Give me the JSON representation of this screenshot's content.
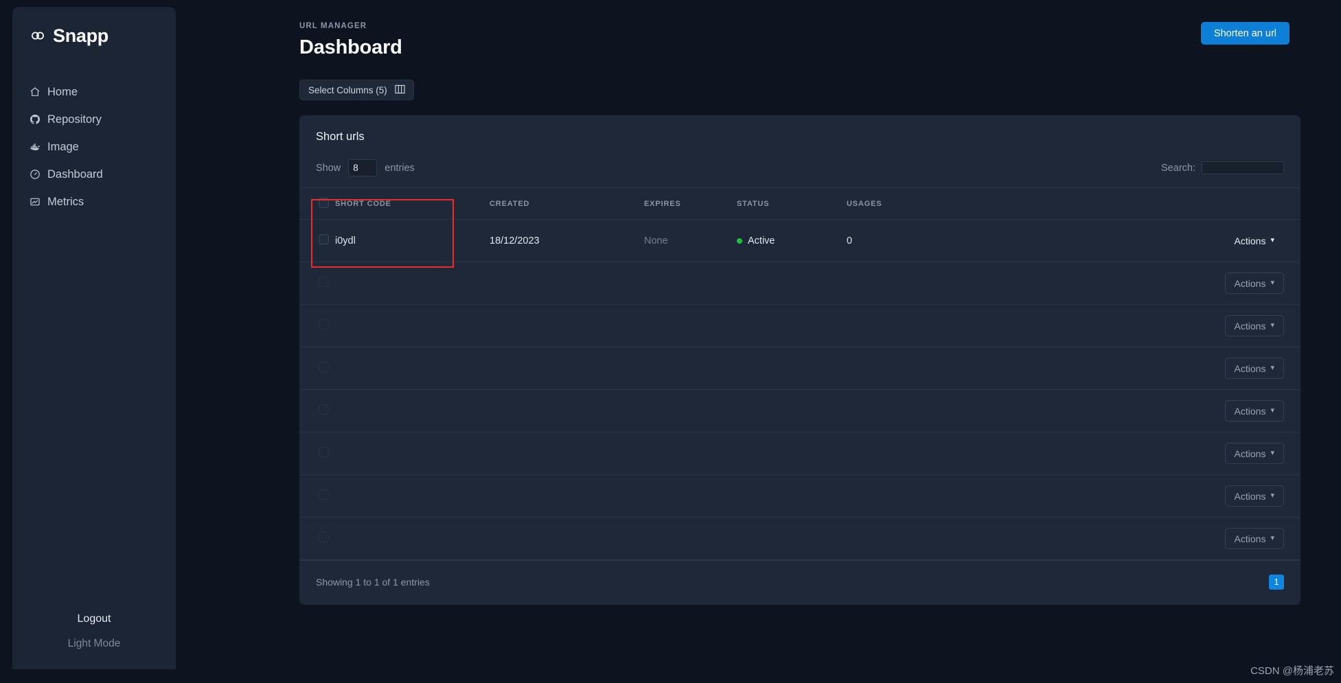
{
  "brand": {
    "name": "Snapp",
    "icon": "links-icon"
  },
  "sidebar": {
    "items": [
      {
        "label": "Home",
        "icon": "home-icon"
      },
      {
        "label": "Repository",
        "icon": "github-icon"
      },
      {
        "label": "Image",
        "icon": "docker-whale-icon"
      },
      {
        "label": "Dashboard",
        "icon": "gauge-icon"
      },
      {
        "label": "Metrics",
        "icon": "chart-icon"
      }
    ],
    "logout_label": "Logout",
    "theme_toggle_label": "Light Mode"
  },
  "header": {
    "eyebrow": "URL MANAGER",
    "title": "Dashboard",
    "primary_button": "Shorten an url"
  },
  "toolbar": {
    "select_columns_label": "Select Columns (5)",
    "columns_icon": "columns-icon"
  },
  "card": {
    "title": "Short urls",
    "show_label": "Show",
    "entries_value": "8",
    "entries_label": "entries",
    "search_label": "Search:",
    "search_value": "",
    "search_placeholder": "",
    "columns": [
      "SHORT CODE",
      "CREATED",
      "EXPIRES",
      "STATUS",
      "USAGES"
    ],
    "rows": [
      {
        "short_code": "i0ydl",
        "created": "18/12/2023",
        "expires": "None",
        "status": "Active",
        "status_color": "#19c23c",
        "usages": "0",
        "actions_label": "Actions"
      }
    ],
    "empty_rows": [
      {
        "actions_label": "Actions"
      },
      {
        "actions_label": "Actions"
      },
      {
        "actions_label": "Actions"
      },
      {
        "actions_label": "Actions"
      },
      {
        "actions_label": "Actions"
      },
      {
        "actions_label": "Actions"
      },
      {
        "actions_label": "Actions"
      }
    ],
    "footer_info": "Showing 1 to 1 of 1 entries",
    "page_number": "1"
  },
  "colors": {
    "accent": "#0e7fd6",
    "page_bg": "#0d141f",
    "sidebar_bg": "#1b2536",
    "card_bg": "#1e2838",
    "annotation": "#ef2b2b",
    "status_active": "#19c23c"
  },
  "watermark": "CSDN @杨浦老苏"
}
